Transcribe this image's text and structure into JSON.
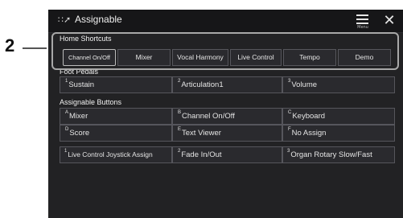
{
  "callout": {
    "number": "2"
  },
  "titlebar": {
    "app_icon": "assignable-icon",
    "title": "Assignable",
    "menu_icon": "menu-icon",
    "menu_label": "Menu",
    "close_icon": "close-icon"
  },
  "home_shortcuts": {
    "label": "Home Shortcuts",
    "buttons": [
      "Channel On/Off",
      "Mixer",
      "Vocal Harmony",
      "Live Control",
      "Tempo",
      "Demo"
    ],
    "selected_index": 0
  },
  "foot_pedals": {
    "label": "Foot Pedals",
    "items": [
      {
        "index": "1",
        "label": "Sustain"
      },
      {
        "index": "2",
        "label": "Articulation1"
      },
      {
        "index": "3",
        "label": "Volume"
      }
    ]
  },
  "assignable_buttons": {
    "label": "Assignable Buttons",
    "items": [
      {
        "index": "A",
        "label": "Mixer"
      },
      {
        "index": "B",
        "label": "Channel On/Off"
      },
      {
        "index": "C",
        "label": "Keyboard"
      },
      {
        "index": "D",
        "label": "Score"
      },
      {
        "index": "E",
        "label": "Text Viewer"
      },
      {
        "index": "F",
        "label": "No Assign"
      }
    ]
  },
  "live_control": {
    "items": [
      {
        "index": "1",
        "label": "Live Control Joystick Assign"
      },
      {
        "index": "2",
        "label": "Fade In/Out"
      },
      {
        "index": "3",
        "label": "Organ Rotary Slow/Fast"
      }
    ]
  },
  "colors": {
    "screen_bg": "#222224",
    "cell_bg": "#2a2a2e",
    "border": "#56565c",
    "text": "#e6e6e6"
  }
}
